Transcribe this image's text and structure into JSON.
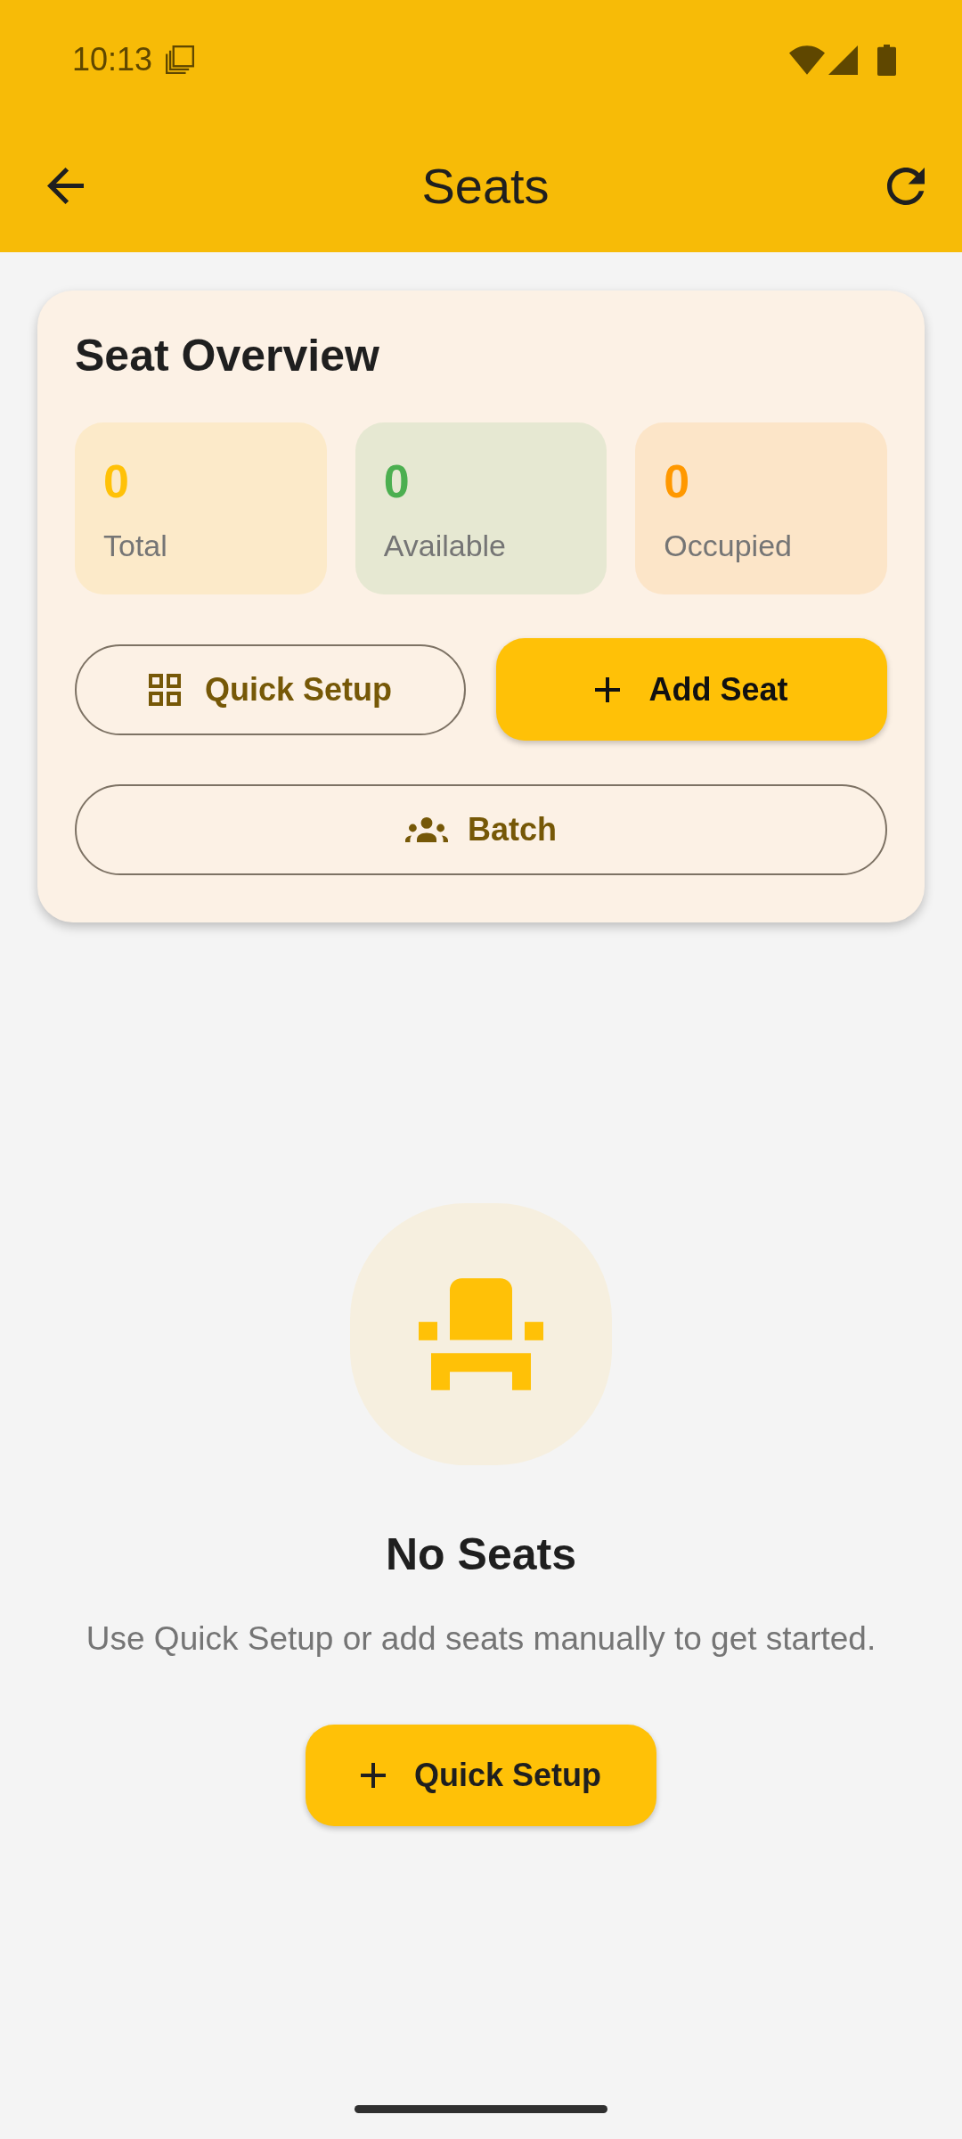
{
  "status_bar": {
    "time": "10:13"
  },
  "app_bar": {
    "title": "Seats"
  },
  "overview": {
    "title": "Seat Overview",
    "stats": [
      {
        "value": "0",
        "label": "Total",
        "color": "#ffc107"
      },
      {
        "value": "0",
        "label": "Available",
        "color": "#4caf50"
      },
      {
        "value": "0",
        "label": "Occupied",
        "color": "#ff9800"
      }
    ],
    "actions": [
      {
        "kind": "quick_setup",
        "label": "Quick Setup"
      },
      {
        "kind": "add_seat",
        "label": "Add Seat"
      },
      {
        "kind": "batch",
        "label": "Batch"
      }
    ]
  },
  "empty_state": {
    "title": "No Seats",
    "message": "Use Quick Setup or add seats manually to get started.",
    "button": {
      "label": "Quick Setup"
    }
  }
}
